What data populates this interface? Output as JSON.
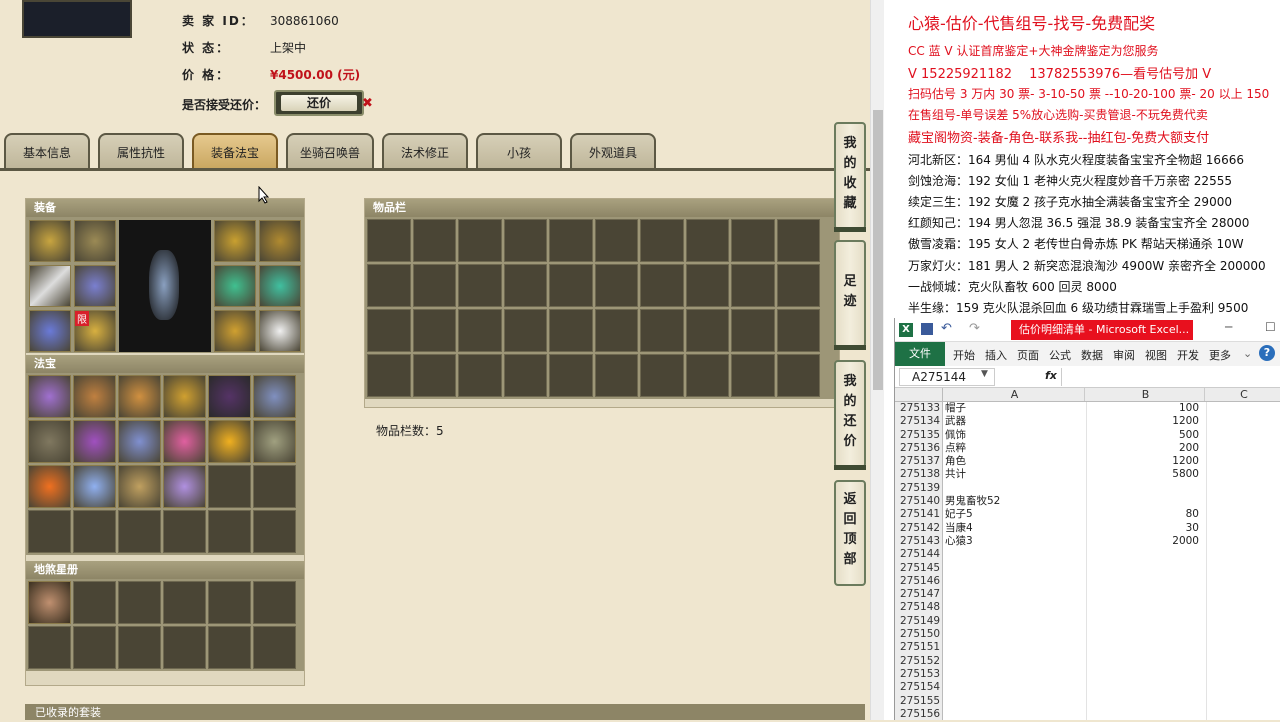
{
  "seller": {
    "id_label": "卖 家 ID：",
    "id_value": "308861060",
    "status_label": "状 态：",
    "status_value": "上架中",
    "price_label": "价 格：",
    "price_value": "¥4500.00 (元)",
    "offer_label": "是否接受还价：",
    "offer_button": "还价",
    "offer_close": "✖"
  },
  "tabs": [
    "基本信息",
    "属性抗性",
    "装备法宝",
    "坐骑召唤兽",
    "法术修正",
    "小孩",
    "外观道具"
  ],
  "active_tab": 2,
  "panels": {
    "equip": "装备",
    "fabao": "法宝",
    "dishaxinglu": "地煞星册",
    "wupin": "物品栏",
    "wupin_count": "物品栏数：5",
    "collected": "已收录的套装",
    "limit_badge": "限"
  },
  "side_buttons": [
    "我的收藏",
    "足迹",
    "我的还价",
    "返回顶部"
  ],
  "promo": {
    "title": "心猿-估价-代售组号-找号-免费配奖",
    "lines": [
      "CC 蓝 V 认证首席鉴定+大神金牌鉴定为您服务",
      "V 15225921182　 13782553976—看号估号加 V",
      "扫码估号 3 万内 30 票- 3-10-50 票 --10-20-100 票- 20 以上 150",
      "在售组号-单号误差 5%放心选购-买贵管退-不玩免费代卖",
      "藏宝阁物资-装备-角色-联系我--抽红包-免费大额支付"
    ],
    "listings": [
      "河北新区：164 男仙 4 队水克火程度装备宝宝齐全物超 16666",
      "剑蚀沧海：192 女仙 1 老神火克火程度妙音千万亲密 22555",
      "续定三生：192 女魔 2 孩子克水抽全满装备宝宝齐全 29000",
      "红颜知己：194 男人忽混 36.5 强混 38.9 装备宝宝齐全 28000",
      "傲雪凌霜：195 女人 2 老传世白骨赤炼 PK 帮站天梯通杀 10W",
      "万家灯火：181 男人 2 新突恋混浪淘沙 4900W 亲密齐全 200000",
      "一战倾城：克火队畜牧 600 回灵 8000",
      "半生缘：159 克火队混杀回血 6 级功绩甘霖瑞雪上手盈利 9500"
    ]
  },
  "excel": {
    "title": "估价明细清单 - Microsoft Excel...",
    "tabs": [
      "文件",
      "开始",
      "插入",
      "页面",
      "公式",
      "数据",
      "审阅",
      "视图",
      "开发",
      "更多"
    ],
    "namebox": "A275144",
    "fx": "fx",
    "cols": [
      "A",
      "B",
      "C"
    ],
    "rows": [
      {
        "n": "275133",
        "a": "帽子",
        "b": "100"
      },
      {
        "n": "275134",
        "a": "武器",
        "b": "1200"
      },
      {
        "n": "275135",
        "a": "佩饰",
        "b": "500"
      },
      {
        "n": "275136",
        "a": "点粹",
        "b": "200"
      },
      {
        "n": "275137",
        "a": "角色",
        "b": "1200"
      },
      {
        "n": "275138",
        "a": "共计",
        "b": "5800"
      },
      {
        "n": "275139",
        "a": "",
        "b": ""
      },
      {
        "n": "275140",
        "a": "男鬼畜牧52",
        "b": ""
      },
      {
        "n": "275141",
        "a": "妃子5",
        "b": "80"
      },
      {
        "n": "275142",
        "a": "当康4",
        "b": "30"
      },
      {
        "n": "275143",
        "a": "心猿3",
        "b": "2000"
      },
      {
        "n": "275144",
        "a": "",
        "b": ""
      },
      {
        "n": "275145",
        "a": "",
        "b": ""
      },
      {
        "n": "275146",
        "a": "",
        "b": ""
      },
      {
        "n": "275147",
        "a": "",
        "b": ""
      },
      {
        "n": "275148",
        "a": "",
        "b": ""
      },
      {
        "n": "275149",
        "a": "",
        "b": ""
      },
      {
        "n": "275150",
        "a": "",
        "b": ""
      },
      {
        "n": "275151",
        "a": "",
        "b": ""
      },
      {
        "n": "275152",
        "a": "",
        "b": ""
      },
      {
        "n": "275153",
        "a": "",
        "b": ""
      },
      {
        "n": "275154",
        "a": "",
        "b": ""
      },
      {
        "n": "275155",
        "a": "",
        "b": ""
      },
      {
        "n": "275156",
        "a": "",
        "b": ""
      }
    ]
  }
}
